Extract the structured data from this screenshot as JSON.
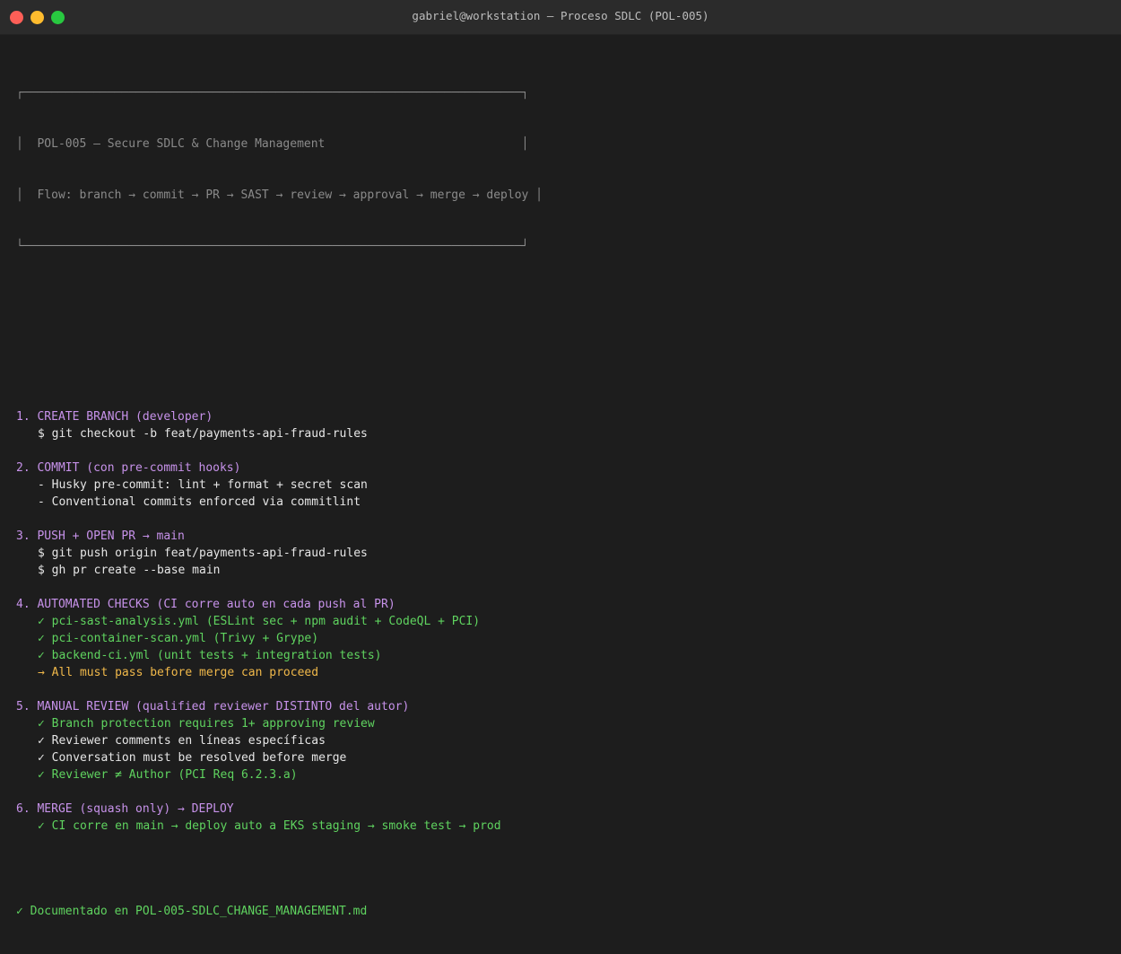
{
  "window": {
    "title": "gabriel@workstation — Proceso SDLC (POL-005)"
  },
  "banner": {
    "top": "┌───────────────────────────────────────────────────────────────────────┐",
    "line1": "│  POL-005 — Secure SDLC & Change Management                            │",
    "line2": "│  Flow: branch → commit → PR → SAST → review → approval → merge → deploy │",
    "bottom": "└───────────────────────────────────────────────────────────────────────┘"
  },
  "steps": [
    {
      "heading": "1. CREATE BRANCH (developer)",
      "lines": [
        {
          "text": "$ git checkout -b feat/payments-api-fraud-rules",
          "color": "white"
        }
      ]
    },
    {
      "heading": "2. COMMIT (con pre-commit hooks)",
      "lines": [
        {
          "text": "- Husky pre-commit: lint + format + secret scan",
          "color": "white"
        },
        {
          "text": "- Conventional commits enforced via commitlint",
          "color": "white"
        }
      ]
    },
    {
      "heading": "3. PUSH + OPEN PR → main",
      "lines": [
        {
          "text": "$ git push origin feat/payments-api-fraud-rules",
          "color": "white"
        },
        {
          "text": "$ gh pr create --base main",
          "color": "white"
        }
      ]
    },
    {
      "heading": "4. AUTOMATED CHECKS (CI corre auto en cada push al PR)",
      "lines": [
        {
          "text": "✓ pci-sast-analysis.yml (ESLint sec + npm audit + CodeQL + PCI)",
          "color": "green"
        },
        {
          "text": "✓ pci-container-scan.yml (Trivy + Grype)",
          "color": "green"
        },
        {
          "text": "✓ backend-ci.yml (unit tests + integration tests)",
          "color": "green"
        },
        {
          "text": "→ All must pass before merge can proceed",
          "color": "yellow"
        }
      ]
    },
    {
      "heading": "5. MANUAL REVIEW (qualified reviewer DISTINTO del autor)",
      "lines": [
        {
          "text": "✓ Branch protection requires 1+ approving review",
          "color": "green"
        },
        {
          "text": "✓ Reviewer comments en líneas específicas",
          "color": "white"
        },
        {
          "text": "✓ Conversation must be resolved before merge",
          "color": "white"
        },
        {
          "text": "✓ Reviewer ≠ Author (PCI Req 6.2.3.a)",
          "color": "green"
        }
      ]
    },
    {
      "heading": "6. MERGE (squash only) → DEPLOY",
      "lines": [
        {
          "text": "✓ CI corre en main → deploy auto a EKS staging → smoke test → prod",
          "color": "green"
        }
      ]
    }
  ],
  "footer": {
    "text": "✓ Documentado en POL-005-SDLC_CHANGE_MANAGEMENT.md",
    "color": "green"
  },
  "colors": {
    "heading": "#c792ea",
    "ok": "#5fd35f",
    "warn": "#f0b84a",
    "text": "#e6e6e6",
    "box": "#8a8a8a"
  }
}
